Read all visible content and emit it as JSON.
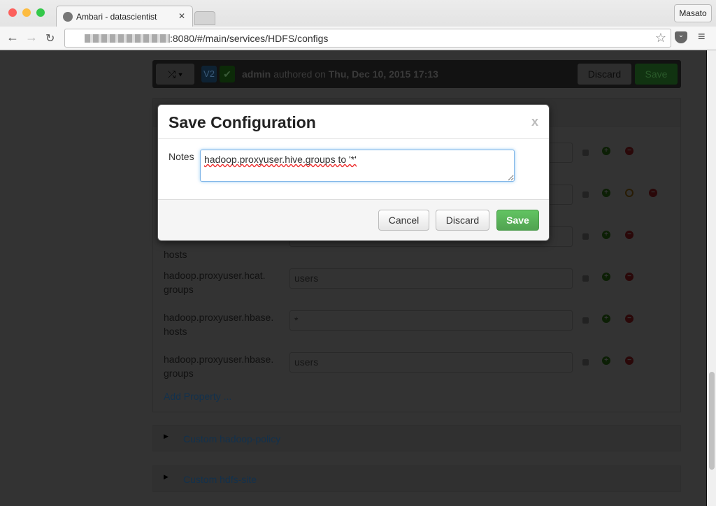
{
  "browser": {
    "tab_title": "Ambari - datascientist",
    "url": ":8080/#/main/services/HDFS/configs",
    "profile": "Masato"
  },
  "version_bar": {
    "version": "V2",
    "author": "admin",
    "authored_text": "authored on",
    "date": "Thu, Dec 10, 2015 17:13",
    "discard_label": "Discard",
    "save_label": "Save"
  },
  "properties": [
    {
      "label": "",
      "value": ""
    },
    {
      "label": "",
      "value": ""
    },
    {
      "label": "hosts",
      "value": ""
    },
    {
      "label": "hadoop.proxyuser.hcat.\ngroups",
      "value": "users"
    },
    {
      "label": "hadoop.proxyuser.hbase.\nhosts",
      "value": "*"
    },
    {
      "label": "hadoop.proxyuser.hbase.\ngroups",
      "value": "users"
    }
  ],
  "add_property": "Add Property ...",
  "sections": [
    "Custom hadoop-policy",
    "Custom hdfs-site"
  ],
  "modal": {
    "title": "Save Configuration",
    "close": "x",
    "notes_label": "Notes",
    "notes_value": "hadoop.proxyuser.hive.groups to '*'",
    "cancel_label": "Cancel",
    "discard_label": "Discard",
    "save_label": "Save"
  },
  "colors": {
    "save_green": "#5bb75b",
    "link_blue": "#2a78b4",
    "version_blue": "#2a6fa8"
  }
}
